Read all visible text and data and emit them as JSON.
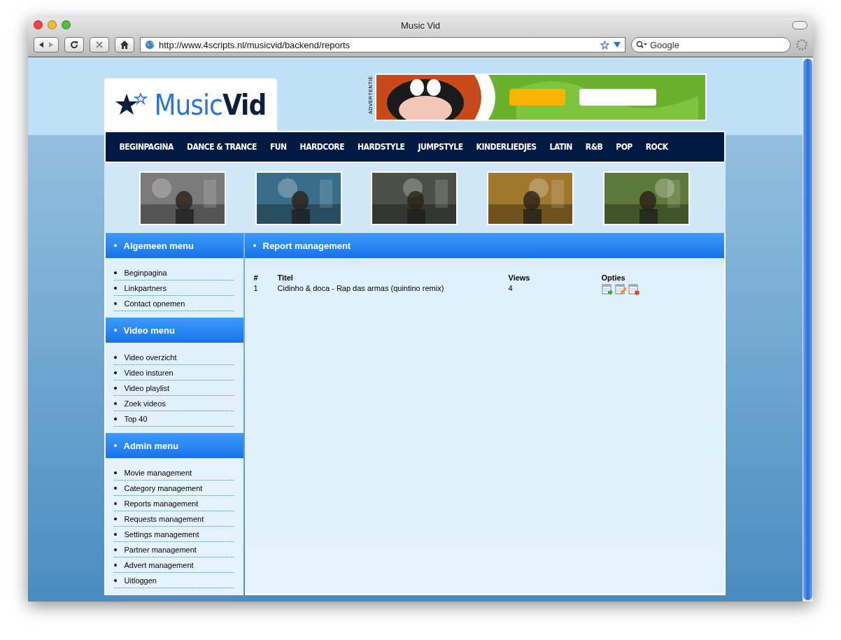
{
  "window": {
    "title": "Music Vid"
  },
  "toolbar": {
    "url": "http://www.4scripts.nl/musicvid/backend/reports",
    "search_placeholder": "Google"
  },
  "logo": {
    "first": "Music",
    "second": "Vid"
  },
  "advert": {
    "label": "ADVERTENTIE"
  },
  "nav": [
    "BEGINPAGINA",
    "DANCE & TRANCE",
    "FUN",
    "HARDCORE",
    "HARDSTYLE",
    "JUMPSTYLE",
    "KINDERLIEDJES",
    "LATIN",
    "R&B",
    "POP",
    "ROCK"
  ],
  "sidebar": [
    {
      "title": "Algemeen menu",
      "items": [
        "Beginpagina",
        "Linkpartners",
        "Contact opnemen"
      ]
    },
    {
      "title": "Video menu",
      "items": [
        "Video overzicht",
        "Video insturen",
        "Video playlist",
        "Zoek videos",
        "Top 40"
      ]
    },
    {
      "title": "Admin menu",
      "items": [
        "Movie management",
        "Category management",
        "Reports management",
        "Requests management",
        "Settings management",
        "Partner management",
        "Advert management",
        "Uitloggen"
      ]
    }
  ],
  "main": {
    "title": "Report management",
    "table": {
      "columns": [
        "#",
        "Titel",
        "Views",
        "Opties"
      ],
      "rows": [
        {
          "cells": [
            "1",
            "Cidinho & doca - Rap das armas (quintino remix)",
            "4"
          ]
        }
      ]
    }
  }
}
